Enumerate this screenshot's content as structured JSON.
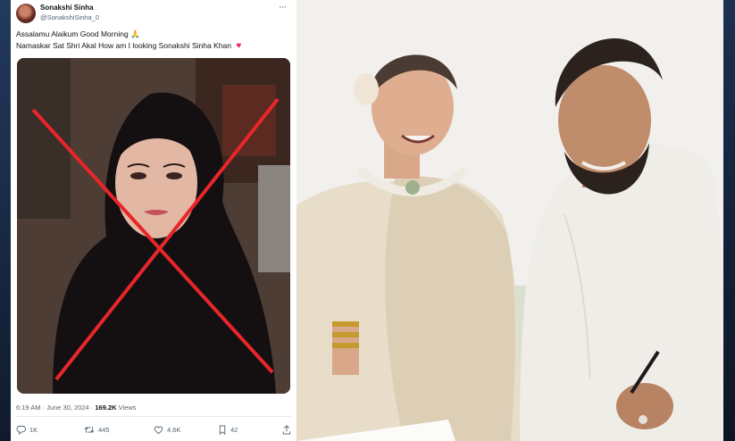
{
  "tweet": {
    "display_name": "Sonakshi Sinha",
    "handle": "@SonakshiSinha_0",
    "more_icon": "more-horizontal-icon",
    "text_line1": "Assalamu Alaikum Good Morning",
    "text_line1_emoji": "🙏",
    "text_line2": "Namaskar Sat Shri Akal How am I looking Sonakshi Sinha Khan",
    "text_line2_emoji": "♥",
    "time": "6:19 AM · June 30, 2024 · ",
    "views_count": "169.2K",
    "views_label": " Views",
    "actions": {
      "reply_count": "1K",
      "retweet_count": "445",
      "like_count": "4.6K",
      "bookmark_count": "42"
    }
  },
  "colors": {
    "cross": "#e8262a",
    "hijab": "#141012",
    "heart": "#e0245e"
  }
}
